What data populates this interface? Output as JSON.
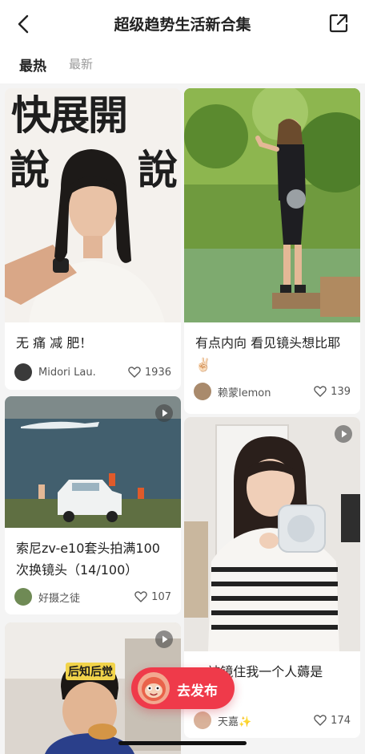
{
  "header": {
    "title": "超级趋势生活新合集"
  },
  "tabs": [
    {
      "label": "最热",
      "active": true
    },
    {
      "label": "最新",
      "active": false
    }
  ],
  "posts": [
    {
      "image_text": {
        "line1": "快展開",
        "line2": "說說"
      },
      "caption": "无 痛 减 肥！",
      "author": "Midori Lau.",
      "likes": "1936",
      "is_video": false
    },
    {
      "caption": "有点内向 看见镜头想比耶✌🏻",
      "author": "赖蒙lemon",
      "likes": "139",
      "is_video": false
    },
    {
      "caption": "索尼zv-e10套头拍满100次换镜头（14/100）",
      "author": "好摄之徒",
      "likes": "107",
      "is_video": true
    },
    {
      "caption": "...被镜住我一个人薅是",
      "author": "天嘉✨",
      "likes": "174",
      "is_video": true
    },
    {
      "image_text": "后知后觉",
      "is_video": true
    }
  ],
  "fab": {
    "label": "去发布"
  },
  "colors": {
    "accent": "#ef3a4a",
    "text_primary": "#222222",
    "text_secondary": "#9a9a9a"
  }
}
